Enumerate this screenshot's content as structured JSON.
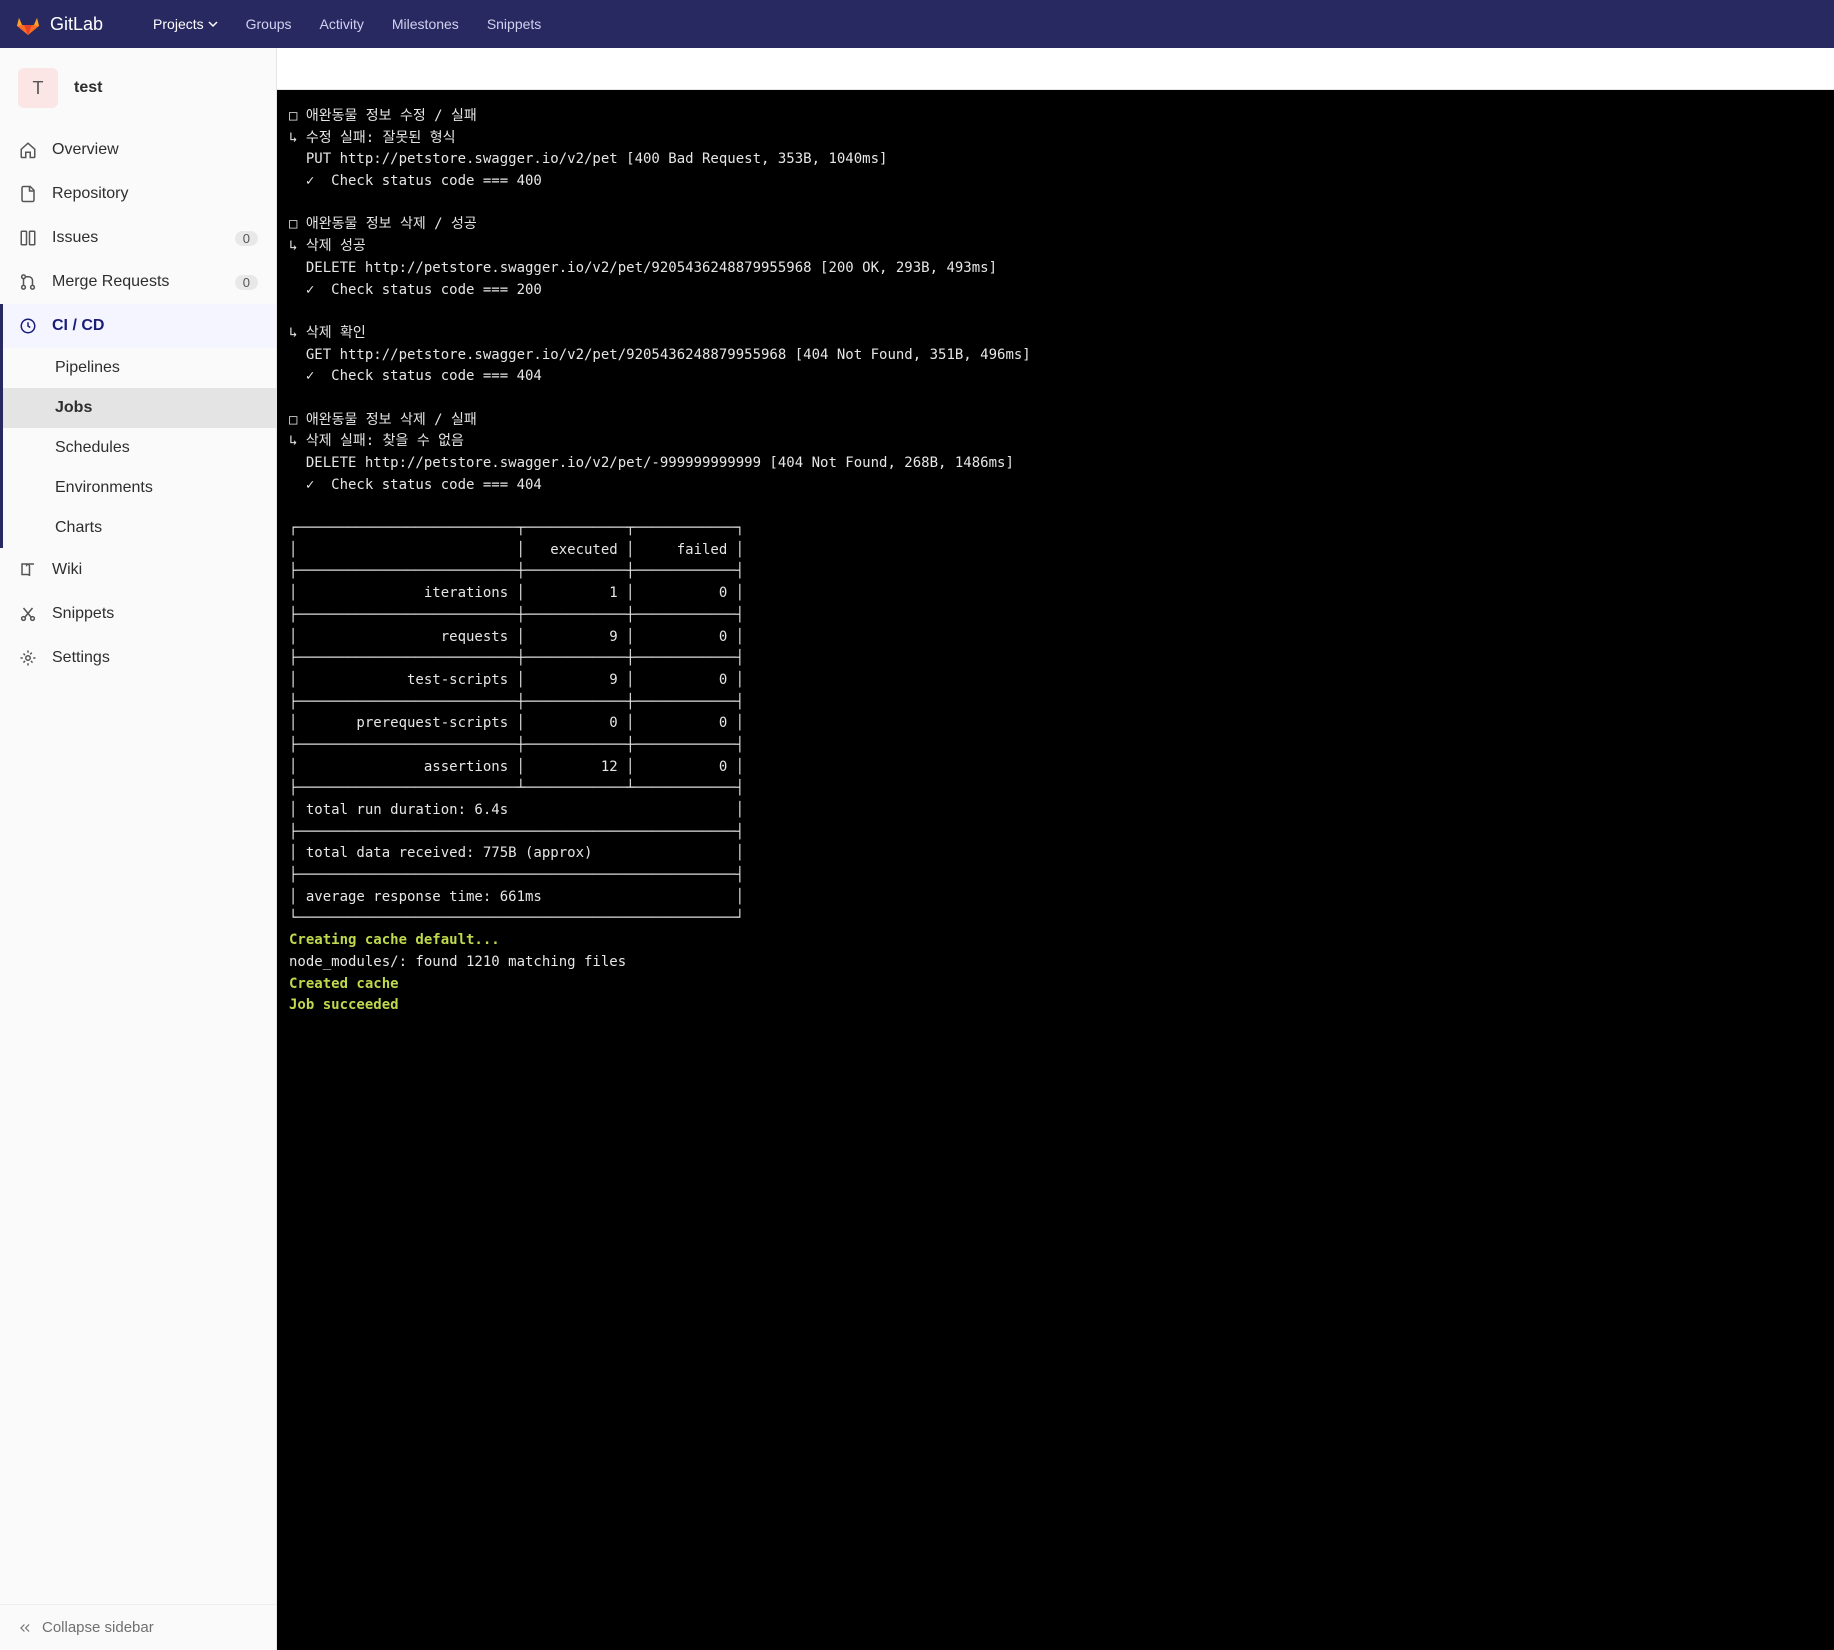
{
  "topbar": {
    "brand": "GitLab",
    "items": [
      "Projects",
      "Groups",
      "Activity",
      "Milestones",
      "Snippets"
    ]
  },
  "project": {
    "avatar_letter": "T",
    "name": "test"
  },
  "sidebar": {
    "items": [
      {
        "icon": "home",
        "label": "Overview"
      },
      {
        "icon": "doc",
        "label": "Repository"
      },
      {
        "icon": "issues",
        "label": "Issues",
        "badge": "0"
      },
      {
        "icon": "merge",
        "label": "Merge Requests",
        "badge": "0"
      },
      {
        "icon": "cicd",
        "label": "CI / CD",
        "active": true,
        "children": [
          {
            "label": "Pipelines"
          },
          {
            "label": "Jobs",
            "selected": true
          },
          {
            "label": "Schedules"
          },
          {
            "label": "Environments"
          },
          {
            "label": "Charts"
          }
        ]
      },
      {
        "icon": "wiki",
        "label": "Wiki"
      },
      {
        "icon": "snippets",
        "label": "Snippets"
      },
      {
        "icon": "settings",
        "label": "Settings"
      }
    ],
    "collapse_label": "Collapse sidebar"
  },
  "terminal": {
    "blocks": [
      {
        "header": "□ 애완동물 정보 수정 / 실패",
        "sub": "↳ 수정 실패: 잘못된 형식",
        "req": "  PUT http://petstore.swagger.io/v2/pet [400 Bad Request, 353B, 1040ms]",
        "check": "  ✓  Check status code === 400"
      },
      {
        "header": "□ 애완동물 정보 삭제 / 성공",
        "sub": "↳ 삭제 성공",
        "req": "  DELETE http://petstore.swagger.io/v2/pet/9205436248879955968 [200 OK, 293B, 493ms]",
        "check": "  ✓  Check status code === 200"
      },
      {
        "sub": "↳ 삭제 확인",
        "req": "  GET http://petstore.swagger.io/v2/pet/9205436248879955968 [404 Not Found, 351B, 496ms]",
        "check": "  ✓  Check status code === 404"
      },
      {
        "header": "□ 애완동물 정보 삭제 / 실패",
        "sub": "↳ 삭제 실패: 찾을 수 없음",
        "req": "  DELETE http://petstore.swagger.io/v2/pet/-999999999999 [404 Not Found, 268B, 1486ms]",
        "check": "  ✓  Check status code === 404"
      }
    ],
    "table": {
      "headers": [
        "",
        "executed",
        "failed"
      ],
      "rows": [
        [
          "iterations",
          "1",
          "0"
        ],
        [
          "requests",
          "9",
          "0"
        ],
        [
          "test-scripts",
          "9",
          "0"
        ],
        [
          "prerequest-scripts",
          "0",
          "0"
        ],
        [
          "assertions",
          "12",
          "0"
        ]
      ],
      "footers": [
        "total run duration: 6.4s",
        "total data received: 775B (approx)",
        "average response time: 661ms"
      ]
    },
    "tail": {
      "l1": "Creating cache default...",
      "l2": "node_modules/: found 1210 matching files",
      "l3": "Created cache",
      "l4": "Job succeeded"
    }
  }
}
